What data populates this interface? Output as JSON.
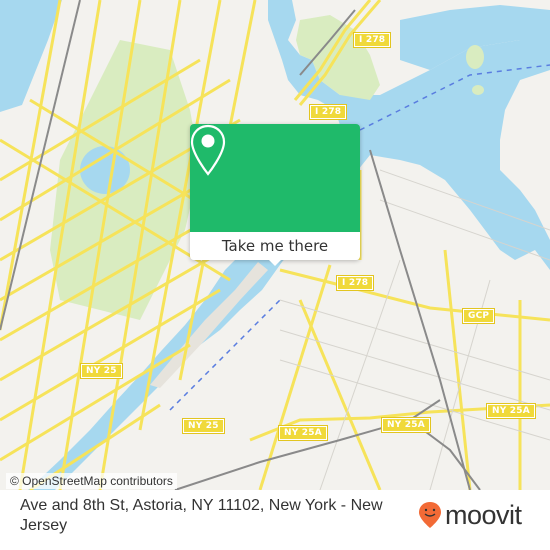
{
  "map": {
    "popup": {
      "icon": "location-pin-icon",
      "button_label": "Take me there",
      "accent_color": "#1fba6a"
    },
    "road_labels": [
      {
        "id": "i278-north",
        "text": "I 278"
      },
      {
        "id": "i278-mid",
        "text": "I 278"
      },
      {
        "id": "i278-east",
        "text": "I 278"
      },
      {
        "id": "gcp",
        "text": "GCP"
      },
      {
        "id": "ny25-west",
        "text": "NY 25"
      },
      {
        "id": "ny25-south",
        "text": "NY 25"
      },
      {
        "id": "ny25a-east",
        "text": "NY 25A"
      },
      {
        "id": "ny25a-mid",
        "text": "NY 25A"
      },
      {
        "id": "ny25a-west",
        "text": "NY 25A"
      }
    ],
    "attribution": "© OpenStreetMap contributors",
    "colors": {
      "water": "#a6d8ef",
      "park": "#d9ecc0",
      "road": "#f6e35a",
      "land": "#f3f2ee"
    }
  },
  "footer": {
    "address": "Ave and 8th St, Astoria, NY 11102, New York - New Jersey",
    "logo_text": "moovit",
    "logo_color": "#f26a36"
  }
}
